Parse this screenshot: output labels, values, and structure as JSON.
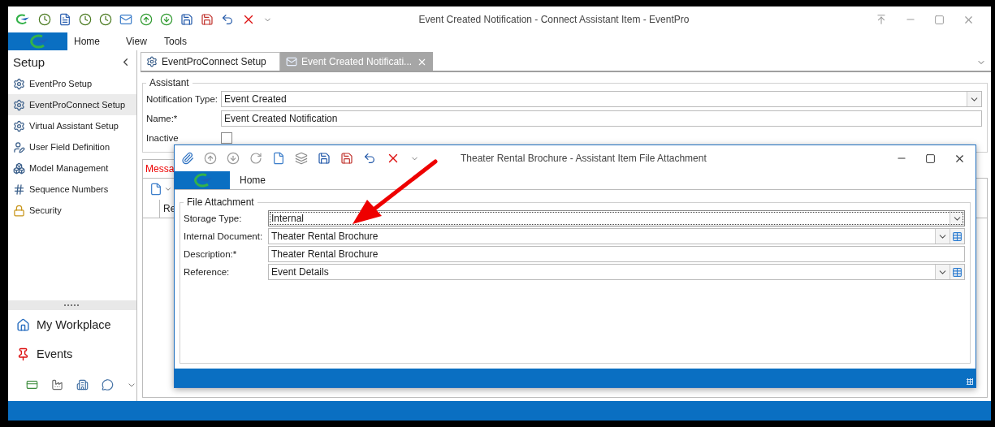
{
  "window": {
    "title": "Event Created Notification - Connect Assistant Item - EventPro"
  },
  "ribbon": {
    "tabs": [
      {
        "label": "Home"
      },
      {
        "label": "View"
      },
      {
        "label": "Tools"
      }
    ]
  },
  "sidebar": {
    "title": "Setup",
    "items": [
      {
        "label": "EventPro Setup",
        "selected": false
      },
      {
        "label": "EventProConnect Setup",
        "selected": true
      },
      {
        "label": "Virtual Assistant Setup",
        "selected": false
      },
      {
        "label": "User Field Definition",
        "selected": false
      },
      {
        "label": "Model Management",
        "selected": false
      },
      {
        "label": "Sequence Numbers",
        "selected": false
      },
      {
        "label": "Security",
        "selected": false
      }
    ],
    "nav": [
      {
        "label": "My Workplace"
      },
      {
        "label": "Events"
      }
    ]
  },
  "doc_tabs": [
    {
      "label": "EventProConnect Setup",
      "selected": false
    },
    {
      "label": "Event Created Notificati...",
      "selected": true
    }
  ],
  "assistant": {
    "title": "Assistant",
    "fields": [
      {
        "label": "Notification Type:",
        "value": "Event Created",
        "kind": "dropdown"
      },
      {
        "label": "Name:*",
        "value": "Event Created Notification",
        "kind": "text"
      }
    ],
    "inactive": {
      "label": "Inactive",
      "checked": false
    }
  },
  "sub_tabs": [
    {
      "label": "Messa",
      "selected": true
    }
  ],
  "grid": {
    "columns": [
      "Re"
    ]
  },
  "dialog": {
    "title": "Theater Rental Brochure - Assistant Item File Attachment",
    "ribbon": {
      "tabs": [
        {
          "label": "Home"
        }
      ]
    },
    "group": {
      "title": "File Attachment",
      "fields": [
        {
          "label": "Storage Type:",
          "value": "Internal",
          "kind": "dropdown",
          "focused": true
        },
        {
          "label": "Internal Document:",
          "value": "Theater Rental Brochure",
          "kind": "lookup",
          "focused": false
        },
        {
          "label": "Description:*",
          "value": "Theater Rental Brochure",
          "kind": "text",
          "focused": false
        },
        {
          "label": "Reference:",
          "value": "Event Details",
          "kind": "lookup",
          "focused": false
        }
      ]
    }
  }
}
